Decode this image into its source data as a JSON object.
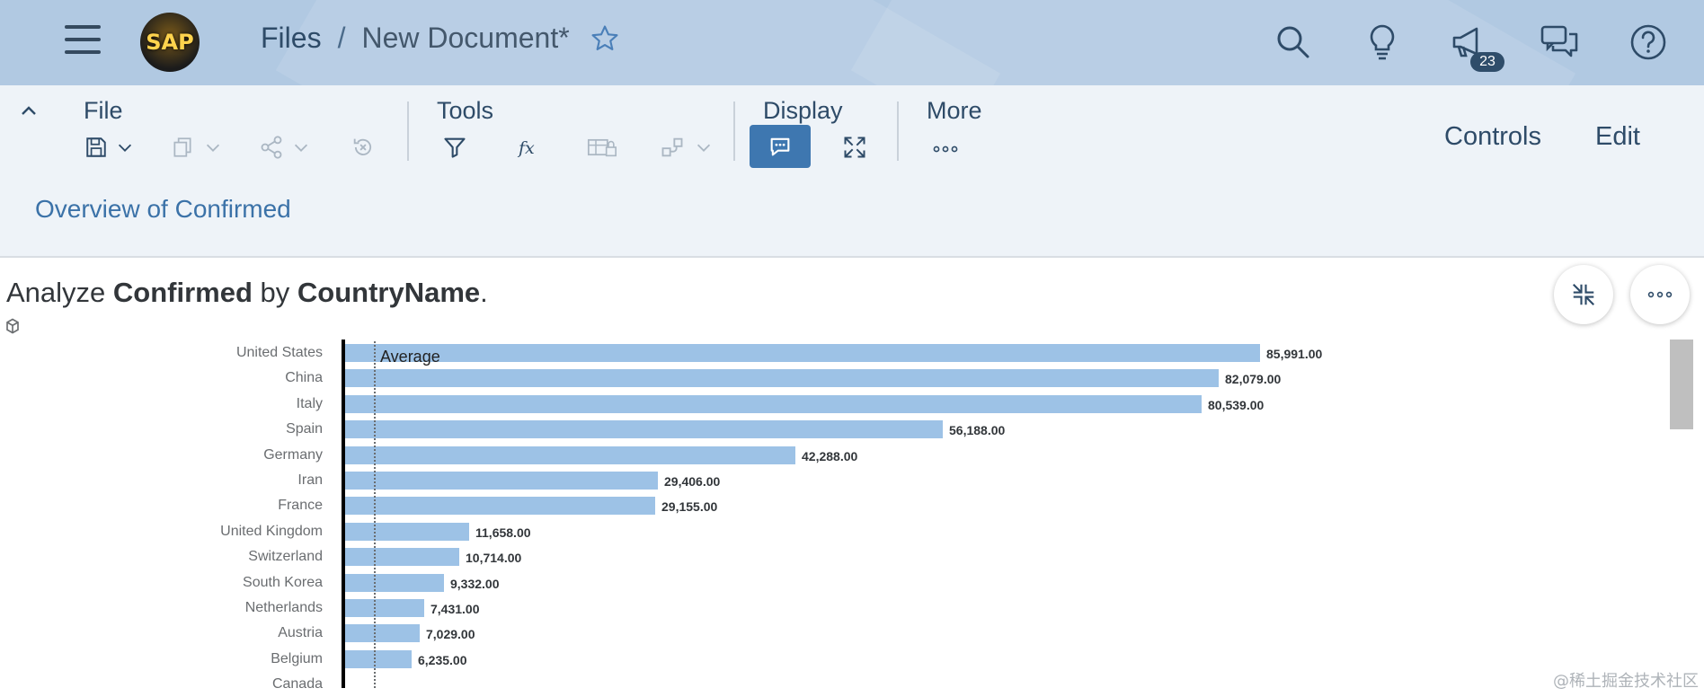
{
  "shell": {
    "logo_text": "SAP",
    "breadcrumb_root": "Files",
    "breadcrumb_sep": "/",
    "document_title": "New Document*",
    "notifications_count": "23",
    "colors": {
      "shell_bg": "#b1c9e2",
      "accent": "#3e77b0"
    }
  },
  "toolbar": {
    "groups": {
      "file": "File",
      "tools": "Tools",
      "display": "Display",
      "more": "More"
    },
    "controls_label": "Controls",
    "edit_label": "Edit",
    "page_link": "Overview of Confirmed"
  },
  "story": {
    "title_prefix": "Analyze ",
    "measure": "Confirmed",
    "title_mid": " by ",
    "dimension": "CountryName",
    "title_suffix": ".",
    "average_label": "Average"
  },
  "chart_data": {
    "type": "bar",
    "orientation": "horizontal",
    "categories": [
      "United States",
      "China",
      "Italy",
      "Spain",
      "Germany",
      "Iran",
      "France",
      "United Kingdom",
      "Switzerland",
      "South Korea",
      "Netherlands",
      "Austria",
      "Belgium",
      "Canada"
    ],
    "values": [
      85991,
      82079,
      80539,
      56188,
      42288,
      29406,
      29155,
      11658,
      10714,
      9332,
      7431,
      7029,
      6235,
      null
    ],
    "value_labels": [
      "85,991.00",
      "82,079.00",
      "80,539.00",
      "56,188.00",
      "42,288.00",
      "29,406.00",
      "29,155.00",
      "11,658.00",
      "10,714.00",
      "9,332.00",
      "7,431.00",
      "7,029.00",
      "6,235.00",
      ""
    ],
    "xlim": [
      0,
      86000
    ],
    "bar_color": "#9dc2e6"
  },
  "watermark": "@稀土掘金技术社区"
}
